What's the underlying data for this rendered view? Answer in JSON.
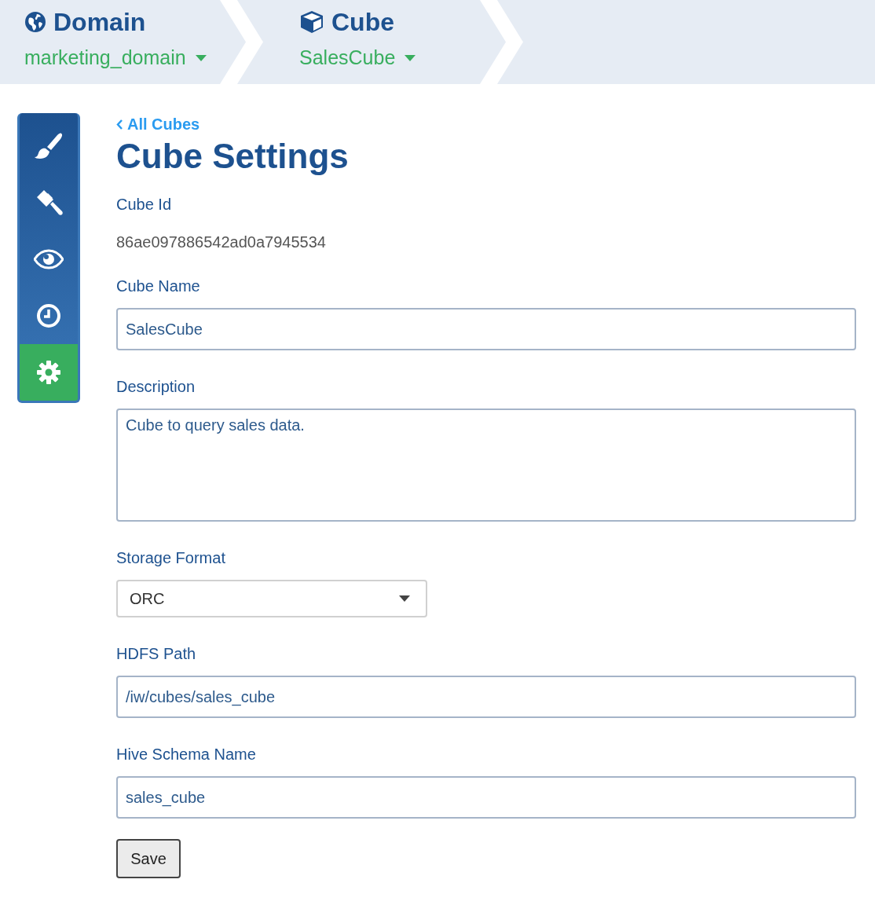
{
  "breadcrumbs": [
    {
      "kind": "domain",
      "title": "Domain",
      "value": "marketing_domain"
    },
    {
      "kind": "cube",
      "title": "Cube",
      "value": "SalesCube"
    }
  ],
  "sidebar": {
    "items": [
      {
        "kind": "brush",
        "selected": false
      },
      {
        "kind": "gavel",
        "selected": false
      },
      {
        "kind": "eye",
        "selected": false
      },
      {
        "kind": "clock",
        "selected": false
      },
      {
        "kind": "gear",
        "selected": true
      }
    ]
  },
  "back_link": "All Cubes",
  "title": "Cube Settings",
  "fields": [
    {
      "kind": "static",
      "label": "Cube Id",
      "value": "86ae097886542ad0a7945534"
    },
    {
      "kind": "input",
      "label": "Cube Name",
      "value": "SalesCube"
    },
    {
      "kind": "textarea",
      "label": "Description",
      "value": "Cube to query sales data."
    },
    {
      "kind": "select",
      "label": "Storage Format",
      "value": "ORC"
    },
    {
      "kind": "input",
      "label": "HDFS Path",
      "value": "/iw/cubes/sales_cube"
    },
    {
      "kind": "input",
      "label": "Hive Schema Name",
      "value": "sales_cube"
    }
  ],
  "save_button": "Save"
}
